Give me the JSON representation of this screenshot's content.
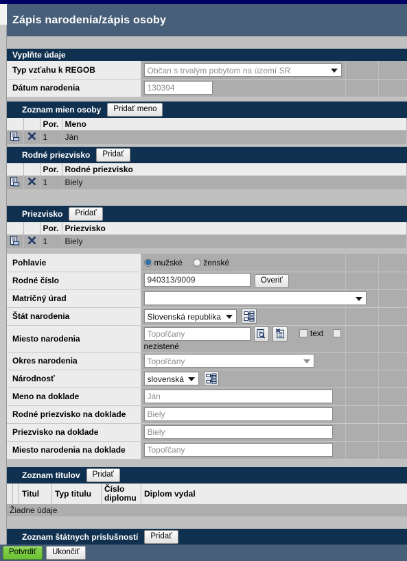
{
  "window": {
    "title": "Zápis narodenia/zápis osoby",
    "accent_navy": "#10304f",
    "accent_steel": "#475f78",
    "accent_green": "#6cc235",
    "topbar_color": "#000066"
  },
  "form_section": {
    "header": "Vyplňte údaje",
    "rows": [
      {
        "label": "Typ vzťahu k REGOB",
        "control": "select",
        "value": "Občan s trvalým pobytom na území SR",
        "name": "typ-vztahu-select"
      },
      {
        "label": "Dátum narodenia",
        "control": "text",
        "value": "130394",
        "name": "datum-narodenia-input"
      }
    ]
  },
  "names_section": {
    "header": "Zoznam mien osoby",
    "add_label": "Pridať meno",
    "columns": [
      "",
      "",
      "Por.",
      "Meno"
    ],
    "rows": [
      {
        "por": "1",
        "value": "Ján",
        "detail_icon": "document-detail-icon",
        "delete_icon": "delete-x-icon"
      }
    ]
  },
  "birth_surname_section": {
    "header": "Rodné priezvisko",
    "add_label": "Pridať",
    "columns": [
      "",
      "",
      "Por.",
      "Rodné priezvisko"
    ],
    "rows": [
      {
        "por": "1",
        "value": "Biely",
        "detail_icon": "document-detail-icon",
        "delete_icon": "delete-x-icon"
      }
    ]
  },
  "surname_section": {
    "header": "Priezvisko",
    "add_label": "Pridať",
    "columns": [
      "",
      "",
      "Por.",
      "Priezvisko"
    ],
    "rows": [
      {
        "por": "1",
        "value": "Biely",
        "detail_icon": "document-detail-icon",
        "delete_icon": "delete-x-icon"
      }
    ]
  },
  "details": {
    "gender": {
      "label": "Pohlavie",
      "options": [
        {
          "label": "mužské",
          "selected": true
        },
        {
          "label": "ženské",
          "selected": false
        }
      ]
    },
    "personal_number": {
      "label": "Rodné číslo",
      "value": "940313/9009",
      "verify_label": "Overiť"
    },
    "registry_office": {
      "label": "Matričný úrad",
      "value": ""
    },
    "birth_country": {
      "label": "Štát narodenia",
      "value": "Slovenská republika",
      "tree_icon": "hierarchy-tree-icon"
    },
    "birth_place": {
      "label": "Miesto narodenia",
      "value": "Topoľčany",
      "search_icon": "search-document-icon",
      "clear_icon": "clear-document-icon",
      "checkbox_text": "text",
      "checkbox_unknown": "nezistené",
      "checkbox_text_checked": false,
      "checkbox_unknown_checked": false
    },
    "birth_district": {
      "label": "Okres narodenia",
      "value": "Topoľčany"
    },
    "nationality": {
      "label": "Národnosť",
      "value": "slovenská",
      "tree_icon": "hierarchy-tree-icon"
    },
    "doc_name": {
      "label": "Meno na doklade",
      "value": "Ján"
    },
    "doc_birth_surname": {
      "label": "Rodné priezvisko na doklade",
      "value": "Biely"
    },
    "doc_surname": {
      "label": "Priezvisko na doklade",
      "value": "Biely"
    },
    "doc_birth_place": {
      "label": "Miesto narodenia na doklade",
      "value": "Topoľčany"
    }
  },
  "titles_section": {
    "header": "Zoznam titulov",
    "add_label": "Pridať",
    "columns": [
      "",
      "",
      "Titul",
      "Typ titulu",
      "Číslo diplomu",
      "Diplom vydal"
    ],
    "empty_text": "Žiadne údaje"
  },
  "citizenship_section": {
    "header": "Zoznam štátnych príslušností",
    "add_label": "Pridať"
  },
  "footer": {
    "confirm_label": "Potvrdiť",
    "cancel_label": "Ukončiť"
  }
}
